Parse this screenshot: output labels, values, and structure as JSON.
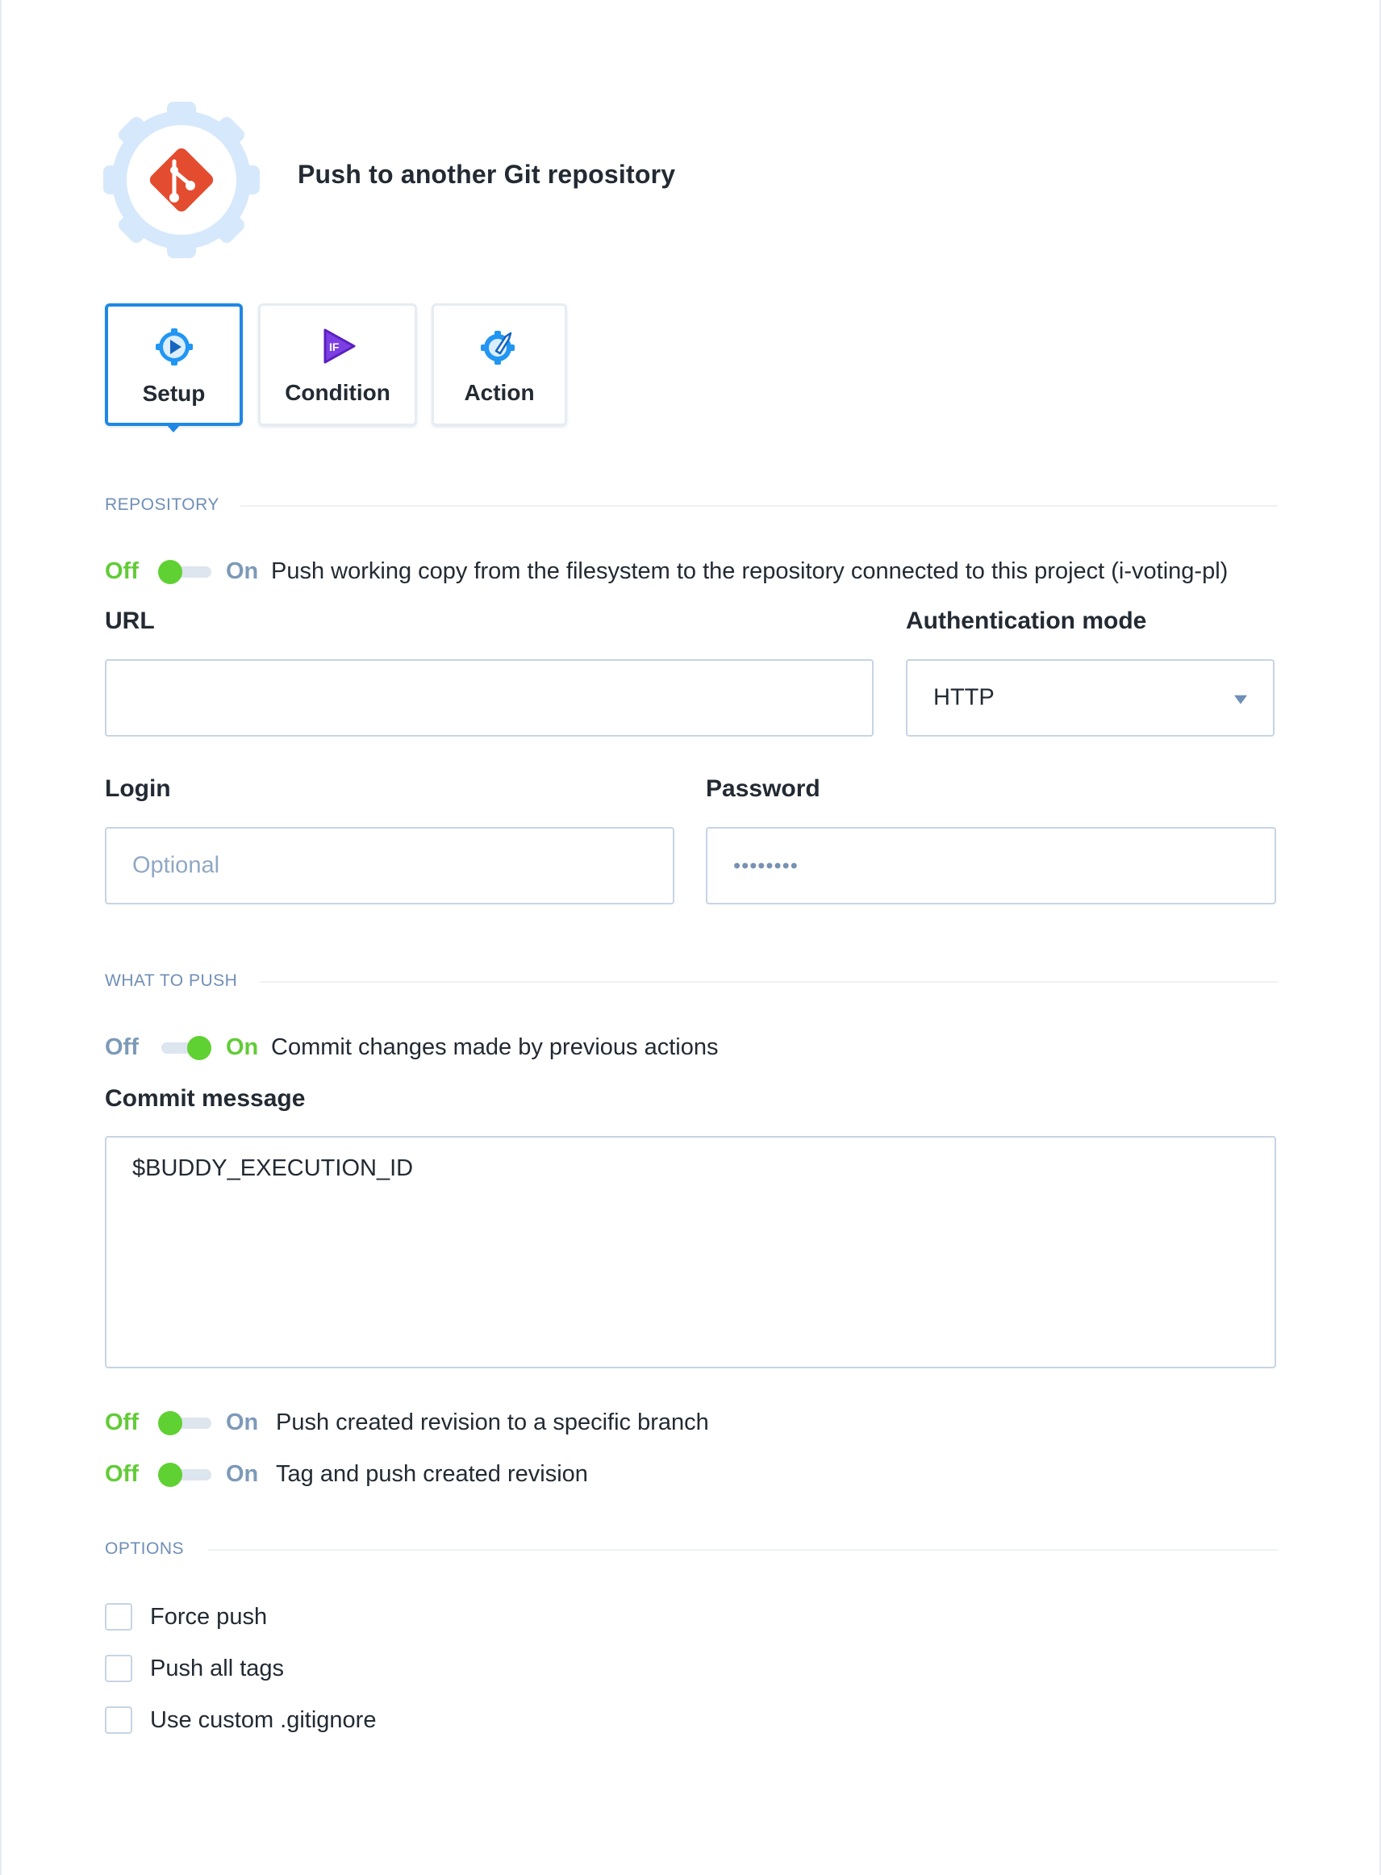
{
  "header": {
    "title": "Push to another Git repository",
    "logo": "git-logo-gear",
    "brand_color": "#e44c30"
  },
  "tabs": [
    {
      "label": "Setup",
      "icon": "gear-play-icon",
      "active": true
    },
    {
      "label": "Condition",
      "icon": "if-play-icon",
      "active": false
    },
    {
      "label": "Action",
      "icon": "gear-hand-icon",
      "active": false
    }
  ],
  "sections": {
    "repository": "REPOSITORY",
    "what_to_push": "WHAT TO PUSH",
    "options": "OPTIONS"
  },
  "toggles": [
    {
      "off_label": "Off",
      "on_label": "On",
      "state": "off",
      "text": "Push working copy from the filesystem to the repository connected to this project (i-voting-pl)"
    },
    {
      "off_label": "Off",
      "on_label": "On",
      "state": "on",
      "text": "Commit changes made by previous actions"
    },
    {
      "off_label": "Off",
      "on_label": "On",
      "state": "off",
      "text": "Push created revision to a specific branch"
    },
    {
      "off_label": "Off",
      "on_label": "On",
      "state": "off",
      "text": "Tag and push created revision"
    }
  ],
  "fields": {
    "url": {
      "label": "URL",
      "value": ""
    },
    "auth_mode": {
      "label": "Authentication mode",
      "value": "HTTP"
    },
    "login": {
      "label": "Login",
      "value": "",
      "placeholder": "Optional"
    },
    "password": {
      "label": "Password",
      "value": "••••••••"
    },
    "commit_message": {
      "label": "Commit message",
      "value": "$BUDDY_EXECUTION_ID"
    }
  },
  "options": [
    {
      "label": "Force push",
      "checked": false
    },
    {
      "label": "Push all tags",
      "checked": false
    },
    {
      "label": "Use custom .gitignore",
      "checked": false
    }
  ],
  "colors": {
    "accent": "#1e88e5",
    "toggle_on": "#5fd132",
    "muted": "#7d9ab8"
  }
}
